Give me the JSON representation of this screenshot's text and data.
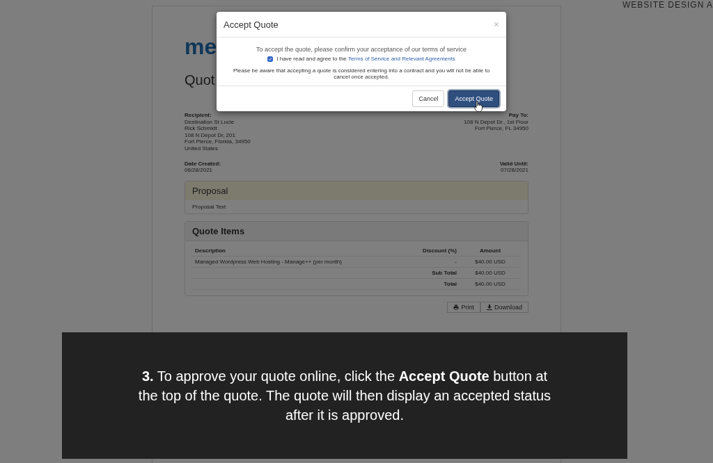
{
  "corner_text": "WEBSITE DESIGN A",
  "document": {
    "logo": "me",
    "title": "Quot",
    "recipient": {
      "label": "Recipient:",
      "lines": [
        "Destination St Lucie",
        "Rick Schmidt",
        "108 N Depot Dr, 201",
        "Fort Pierce, Florida, 34950",
        "United States"
      ]
    },
    "pay_to": {
      "label": "Pay To:",
      "lines": [
        "108 N Depot Dr., 1st Floor",
        "Fort Pierce, FL 34950"
      ]
    },
    "date_created": {
      "label": "Date Created:",
      "value": "06/28/2021"
    },
    "valid_until": {
      "label": "Valid Until:",
      "value": "07/28/2021"
    },
    "proposal": {
      "title": "Proposal",
      "text": "Proposal Text"
    },
    "quote_items": {
      "title": "Quote Items",
      "columns": [
        "Description",
        "Discount (%)",
        "Amount"
      ],
      "rows": [
        {
          "kind": "item",
          "description": "Managed Wordpress Web Hosting - Manage++ (per month)",
          "discount": "-",
          "amount": "$40.00 USD"
        },
        {
          "kind": "total",
          "label": "Sub Total",
          "amount": "$40.00 USD"
        },
        {
          "kind": "total",
          "label": "Total",
          "amount": "$40.00 USD"
        }
      ]
    },
    "buttons": [
      "Print",
      "Download"
    ]
  },
  "modal": {
    "title": "Accept Quote",
    "close": "×",
    "intro": "To accept the quote, please confirm your acceptance of our terms of service",
    "agree": {
      "checked": true,
      "text": "I have read and agree to the ",
      "link": "Terms of Service and Relevant Agreements"
    },
    "notice": "Please be aware that accepting a quote is considered entering into a contract and you will not be able to cancel once accepted.",
    "buttons": [
      {
        "label": "Cancel",
        "kind": "default"
      },
      {
        "label": "Accept Quote",
        "kind": "primary"
      }
    ]
  },
  "caption": "**3.** To approve your quote online, click the **Accept Quote** button at the top of the quote. The quote will then display an accepted status after it is approved."
}
